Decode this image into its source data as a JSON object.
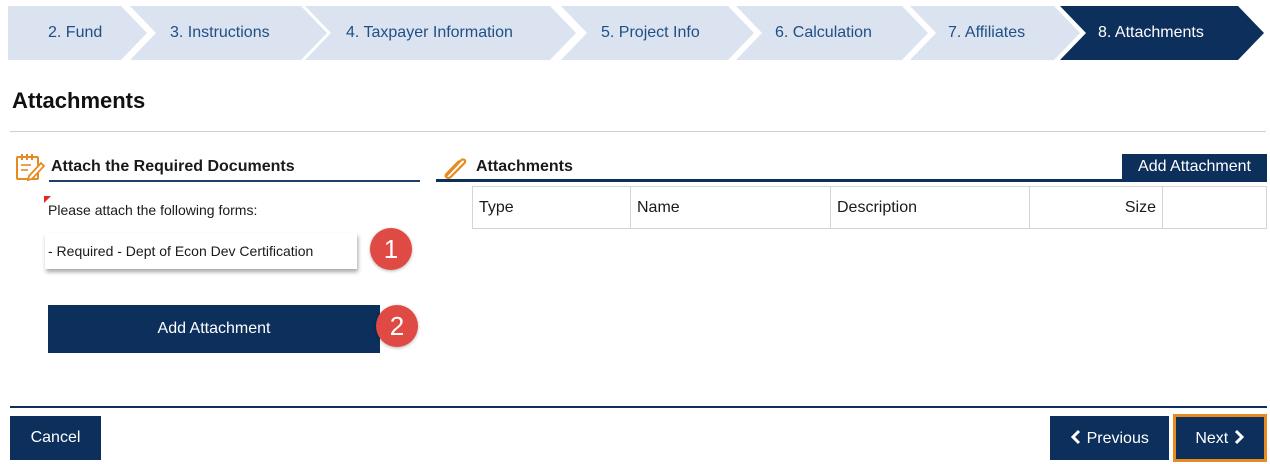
{
  "wizard": {
    "steps": [
      {
        "label": "2. Fund",
        "active": false
      },
      {
        "label": "3. Instructions",
        "active": false
      },
      {
        "label": "4. Taxpayer Information",
        "active": false
      },
      {
        "label": "5. Project Info",
        "active": false
      },
      {
        "label": "6. Calculation",
        "active": false
      },
      {
        "label": "7. Affiliates",
        "active": false
      },
      {
        "label": "8. Attachments",
        "active": true
      }
    ]
  },
  "page": {
    "title": "Attachments"
  },
  "required_docs": {
    "heading": "Attach the Required Documents",
    "instructions": "Please attach the following forms:",
    "items": [
      "- Required - Dept of Econ Dev Certification"
    ],
    "add_button": "Add Attachment",
    "icon": "edit-document-icon"
  },
  "callouts": {
    "one": "1",
    "two": "2"
  },
  "attachments": {
    "heading": "Attachments",
    "add_button": "Add Attachment",
    "icon": "paperclip-icon",
    "columns": [
      "Type",
      "Name",
      "Description",
      "Size",
      ""
    ],
    "rows": []
  },
  "footer": {
    "cancel": "Cancel",
    "previous": "Previous",
    "next": "Next"
  },
  "colors": {
    "primary": "#0c2f5c",
    "step_inactive": "#dae3ef",
    "badge": "#e04a45",
    "focus": "#e78a1f"
  }
}
